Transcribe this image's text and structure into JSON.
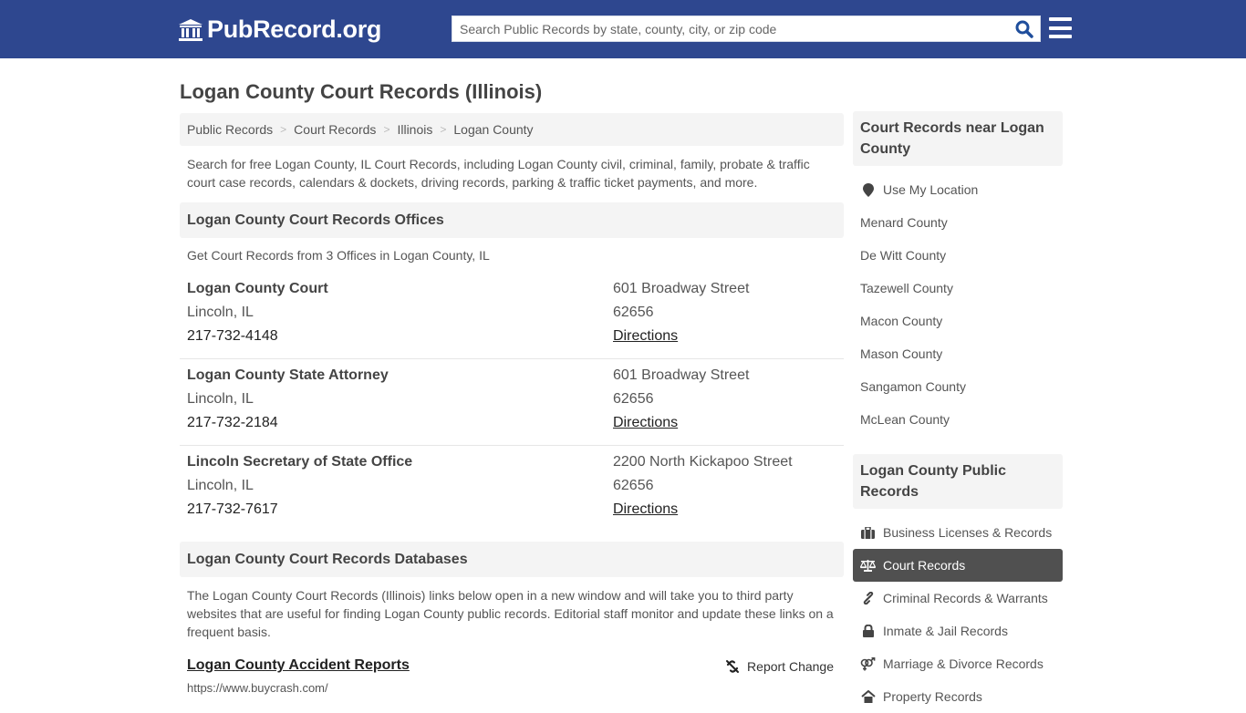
{
  "header": {
    "logo_text": "PubRecord.org",
    "logo_icon": "courthouse-icon",
    "search_placeholder": "Search Public Records by state, county, city, or zip code",
    "search_value": "",
    "search_icon": "search-icon",
    "menu_icon": "hamburger-menu-icon"
  },
  "page": {
    "title": "Logan County Court Records (Illinois)"
  },
  "breadcrumb": [
    {
      "label": "Public Records"
    },
    {
      "label": "Court Records"
    },
    {
      "label": "Illinois"
    },
    {
      "label": "Logan County"
    }
  ],
  "breadcrumb_separator": ">",
  "intro": "Search for free Logan County, IL Court Records, including Logan County civil, criminal, family, probate & traffic court case records, calendars & dockets, driving records, parking & traffic ticket payments, and more.",
  "offices": {
    "heading": "Logan County Court Records Offices",
    "subtitle": "Get Court Records from 3 Offices in Logan County, IL",
    "items": [
      {
        "name": "Logan County Court",
        "city": "Lincoln, IL",
        "phone": "217-732-4148",
        "street": "601 Broadway Street",
        "zip": "62656",
        "directions": "Directions"
      },
      {
        "name": "Logan County State Attorney",
        "city": "Lincoln, IL",
        "phone": "217-732-2184",
        "street": "601 Broadway Street",
        "zip": "62656",
        "directions": "Directions"
      },
      {
        "name": "Lincoln Secretary of State Office",
        "city": "Lincoln, IL",
        "phone": "217-732-7617",
        "street": "2200 North Kickapoo Street",
        "zip": "62656",
        "directions": "Directions"
      }
    ]
  },
  "databases": {
    "heading": "Logan County Court Records Databases",
    "description": "The Logan County Court Records (Illinois) links below open in a new window and will take you to third party websites that are useful for finding Logan County public records. Editorial staff monitor and update these links on a frequent basis.",
    "items": [
      {
        "title": "Logan County Accident Reports",
        "url": "https://www.buycrash.com/",
        "report_label": "Report Change",
        "report_icon": "broken-link-icon"
      }
    ]
  },
  "sidebar": {
    "nearby": {
      "heading": "Court Records near Logan County",
      "location_label": "Use My Location",
      "location_icon": "map-marker-icon",
      "counties": [
        "Menard County",
        "De Witt County",
        "Tazewell County",
        "Macon County",
        "Mason County",
        "Sangamon County",
        "McLean County"
      ]
    },
    "public_records": {
      "heading": "Logan County Public Records",
      "items": [
        {
          "label": "Business Licenses & Records",
          "icon": "briefcase-icon",
          "active": false
        },
        {
          "label": "Court Records",
          "icon": "balance-scale-icon",
          "active": true
        },
        {
          "label": "Criminal Records & Warrants",
          "icon": "link-icon",
          "active": false
        },
        {
          "label": "Inmate & Jail Records",
          "icon": "lock-icon",
          "active": false
        },
        {
          "label": "Marriage & Divorce Records",
          "icon": "venus-mars-icon",
          "active": false
        },
        {
          "label": "Property Records",
          "icon": "home-icon",
          "active": false
        }
      ]
    }
  },
  "colors": {
    "header_bg": "#2e478f",
    "search_icon": "#1f4e9c",
    "active_item_bg": "#505050",
    "section_bg": "#f4f4f4"
  }
}
